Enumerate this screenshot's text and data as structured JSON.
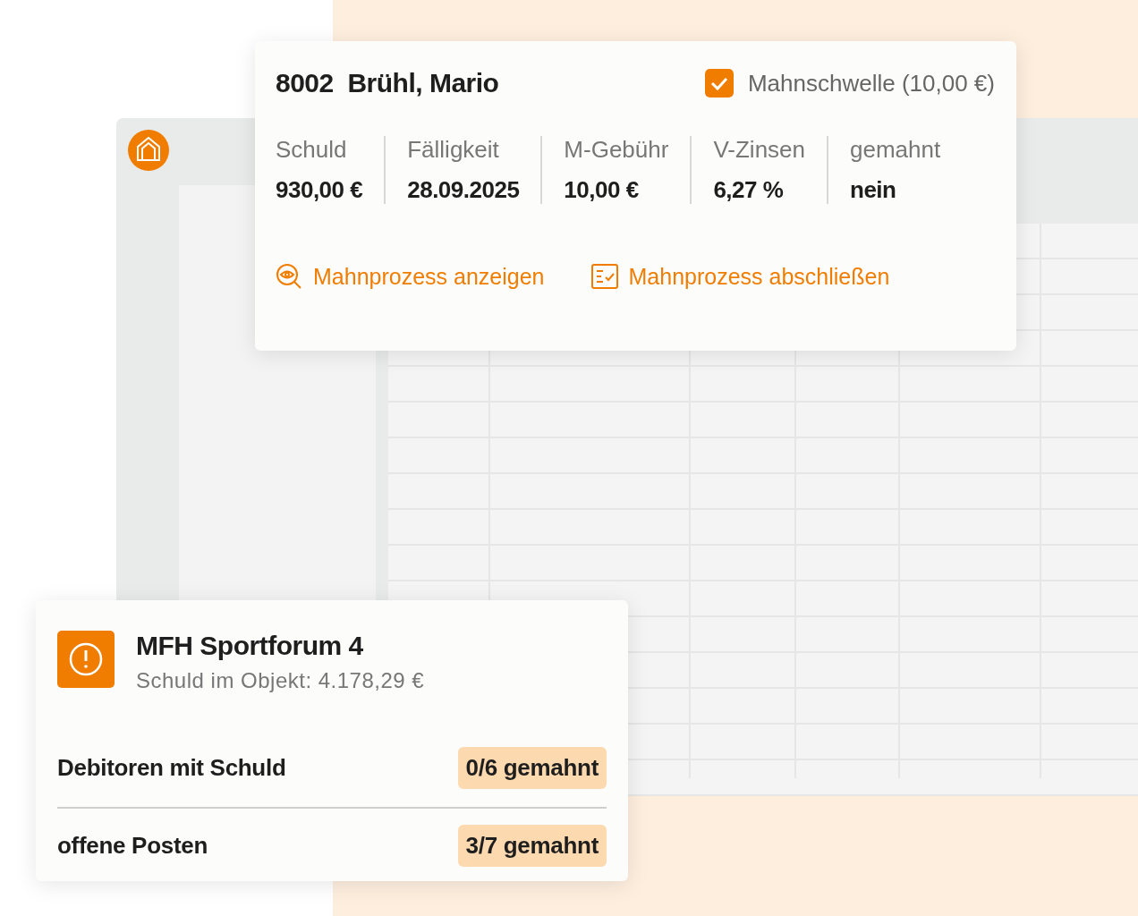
{
  "debtor_card": {
    "number": "8002",
    "name": "Brühl, Mario",
    "threshold": {
      "label": "Mahnschwelle (10,00 €)",
      "checked": true
    },
    "fields": [
      {
        "label": "Schuld",
        "value": "930,00 €"
      },
      {
        "label": "Fälligkeit",
        "value": "28.09.2025"
      },
      {
        "label": "M-Gebühr",
        "value": "10,00 €"
      },
      {
        "label": "V-Zinsen",
        "value": "6,27 %"
      },
      {
        "label": "gemahnt",
        "value": "nein"
      }
    ],
    "actions": [
      {
        "kind": "view",
        "label": "Mahnprozess anzeigen"
      },
      {
        "kind": "close",
        "label": "Mahnprozess abschließen"
      }
    ]
  },
  "property_card": {
    "title": "MFH Sportforum 4",
    "subtitle": "Schuld im Objekt: 4.178,29 €",
    "rows": [
      {
        "label": "Debitoren mit Schuld",
        "badge": "0/6 gemahnt"
      },
      {
        "label": "offene Posten",
        "badge": "3/7 gemahnt"
      }
    ]
  }
}
